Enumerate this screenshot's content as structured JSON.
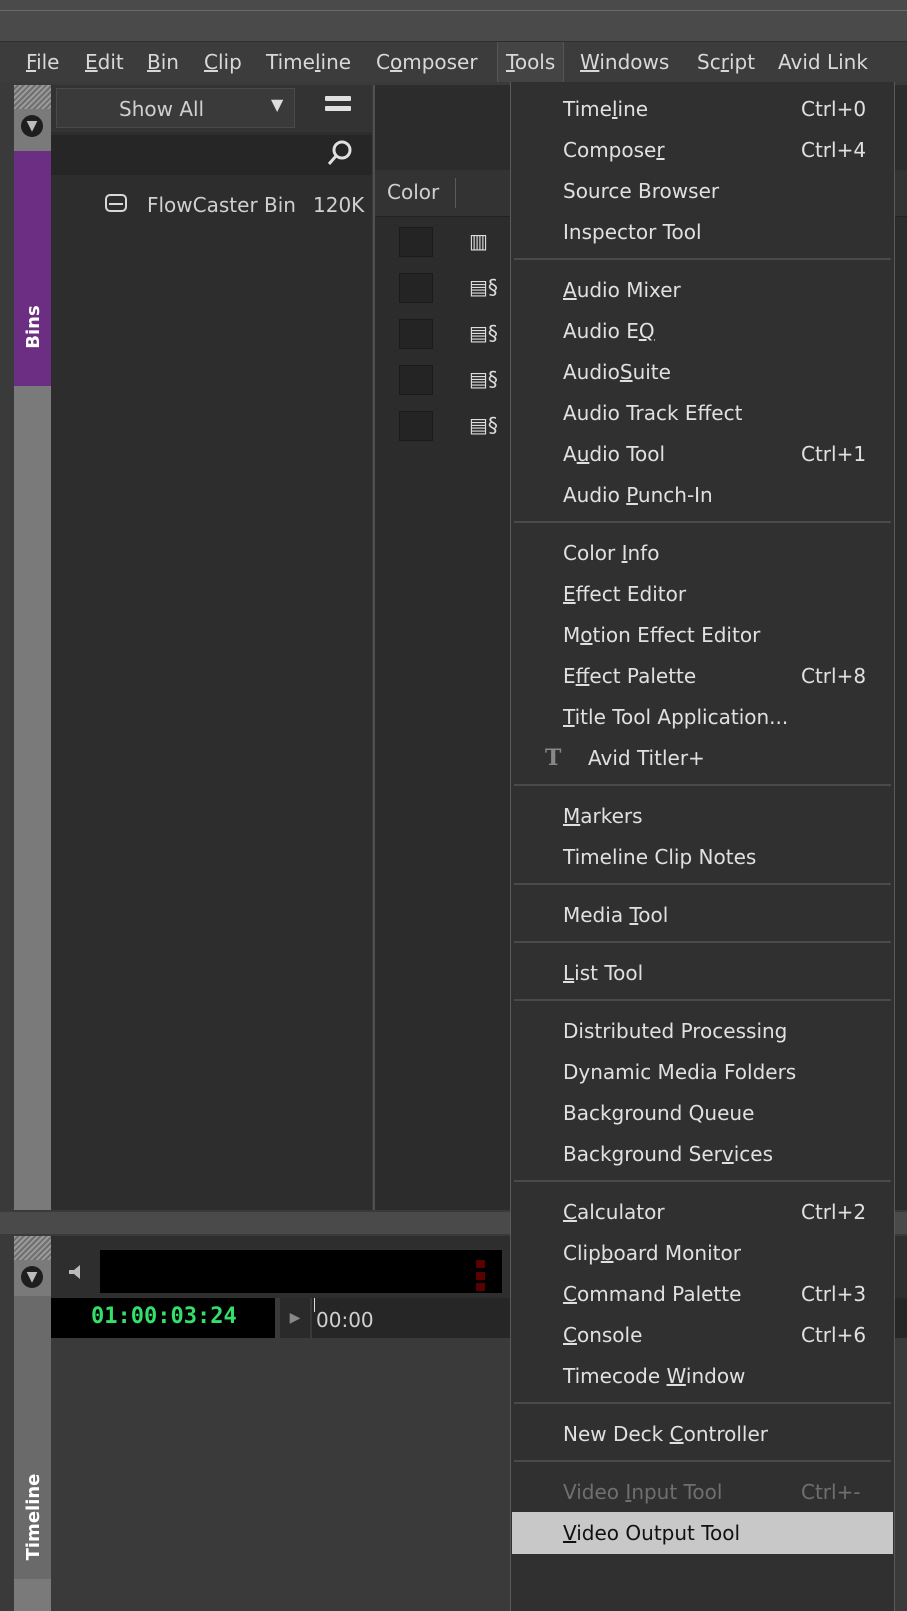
{
  "menubar": {
    "items": [
      {
        "pre": "",
        "u": "F",
        "post": "ile"
      },
      {
        "pre": "",
        "u": "E",
        "post": "dit"
      },
      {
        "pre": "",
        "u": "B",
        "post": "in"
      },
      {
        "pre": "",
        "u": "C",
        "post": "lip"
      },
      {
        "pre": "Time",
        "u": "l",
        "post": "ine"
      },
      {
        "pre": "C",
        "u": "o",
        "post": "mposer"
      },
      {
        "pre": "",
        "u": "T",
        "post": "ools"
      },
      {
        "pre": "",
        "u": "W",
        "post": "indows"
      },
      {
        "pre": "Sc",
        "u": "r",
        "post": "ipt"
      },
      {
        "pre": "Avid Link",
        "u": "",
        "post": ""
      }
    ],
    "open_index": 6
  },
  "bins_panel": {
    "tab_label": "Bins",
    "view_select": "Show All",
    "bin_name": "FlowCaster Bin",
    "bin_size": "120K"
  },
  "bin_content": {
    "column_header": "Color",
    "row_icons": [
      "film-icon",
      "sequence-icon",
      "sequence-icon",
      "sequence-icon",
      "sequence-icon"
    ],
    "row_icon_glyphs": [
      "▥",
      "▤§",
      "▤§",
      "▤§",
      "▤§"
    ]
  },
  "timeline_panel": {
    "tab_label": "Timeline",
    "timecode": "01:00:03:24",
    "ruler_start": "00:00"
  },
  "tools_menu": {
    "groups": [
      [
        {
          "pre": "Time",
          "u": "l",
          "post": "ine",
          "shortcut": "Ctrl+0"
        },
        {
          "pre": "Compose",
          "u": "r",
          "post": "",
          "shortcut": "Ctrl+4"
        },
        {
          "pre": "Source Browser",
          "u": "",
          "post": "",
          "shortcut": ""
        },
        {
          "pre": "Inspector Tool",
          "u": "",
          "post": "",
          "shortcut": ""
        }
      ],
      [
        {
          "pre": "",
          "u": "A",
          "post": "udio Mixer",
          "shortcut": ""
        },
        {
          "pre": "Audio E",
          "u": "Q",
          "post": "",
          "shortcut": ""
        },
        {
          "pre": "Audio",
          "u": "S",
          "post": "uite",
          "shortcut": ""
        },
        {
          "pre": "Audio Track Effect",
          "u": "",
          "post": "",
          "shortcut": ""
        },
        {
          "pre": "A",
          "u": "u",
          "post": "dio Tool",
          "shortcut": "Ctrl+1"
        },
        {
          "pre": "Audio ",
          "u": "P",
          "post": "unch-In",
          "shortcut": ""
        }
      ],
      [
        {
          "pre": "Color ",
          "u": "I",
          "post": "nfo",
          "shortcut": ""
        },
        {
          "pre": "",
          "u": "E",
          "post": "ffect Editor",
          "shortcut": ""
        },
        {
          "pre": "M",
          "u": "o",
          "post": "tion Effect Editor",
          "shortcut": ""
        },
        {
          "pre": "E",
          "u": "f",
          "post": "fect Palette",
          "shortcut": "Ctrl+8"
        },
        {
          "pre": "",
          "u": "T",
          "post": "itle Tool Application...",
          "shortcut": ""
        },
        {
          "pre": "Avid Titler+",
          "u": "",
          "post": "",
          "shortcut": "",
          "icon": "titler-icon"
        }
      ],
      [
        {
          "pre": "",
          "u": "M",
          "post": "arkers",
          "shortcut": ""
        },
        {
          "pre": "Timeline Clip Notes",
          "u": "",
          "post": "",
          "shortcut": ""
        }
      ],
      [
        {
          "pre": "Media ",
          "u": "T",
          "post": "ool",
          "shortcut": ""
        }
      ],
      [
        {
          "pre": "",
          "u": "L",
          "post": "ist Tool",
          "shortcut": ""
        }
      ],
      [
        {
          "pre": "Distributed Processing",
          "u": "",
          "post": "",
          "shortcut": ""
        },
        {
          "pre": "Dynamic Media Folders",
          "u": "",
          "post": "",
          "shortcut": ""
        },
        {
          "pre": "Background Queue",
          "u": "",
          "post": "",
          "shortcut": ""
        },
        {
          "pre": "Background Ser",
          "u": "v",
          "post": "ices",
          "shortcut": ""
        }
      ],
      [
        {
          "pre": "",
          "u": "C",
          "post": "alculator",
          "shortcut": "Ctrl+2"
        },
        {
          "pre": "Clip",
          "u": "b",
          "post": "oard Monitor",
          "shortcut": ""
        },
        {
          "pre": "",
          "u": "C",
          "post": "ommand Palette",
          "shortcut": "Ctrl+3"
        },
        {
          "pre": "",
          "u": "C",
          "post": "onsole",
          "shortcut": "Ctrl+6"
        },
        {
          "pre": "Timecode ",
          "u": "W",
          "post": "indow",
          "shortcut": ""
        }
      ],
      [
        {
          "pre": "New Deck ",
          "u": "C",
          "post": "ontroller",
          "shortcut": ""
        }
      ],
      [
        {
          "pre": "Video ",
          "u": "I",
          "post": "nput Tool",
          "shortcut": "Ctrl+-",
          "disabled": true
        },
        {
          "pre": "",
          "u": "V",
          "post": "ideo Output Tool",
          "shortcut": "",
          "highlighted": true
        }
      ]
    ]
  }
}
